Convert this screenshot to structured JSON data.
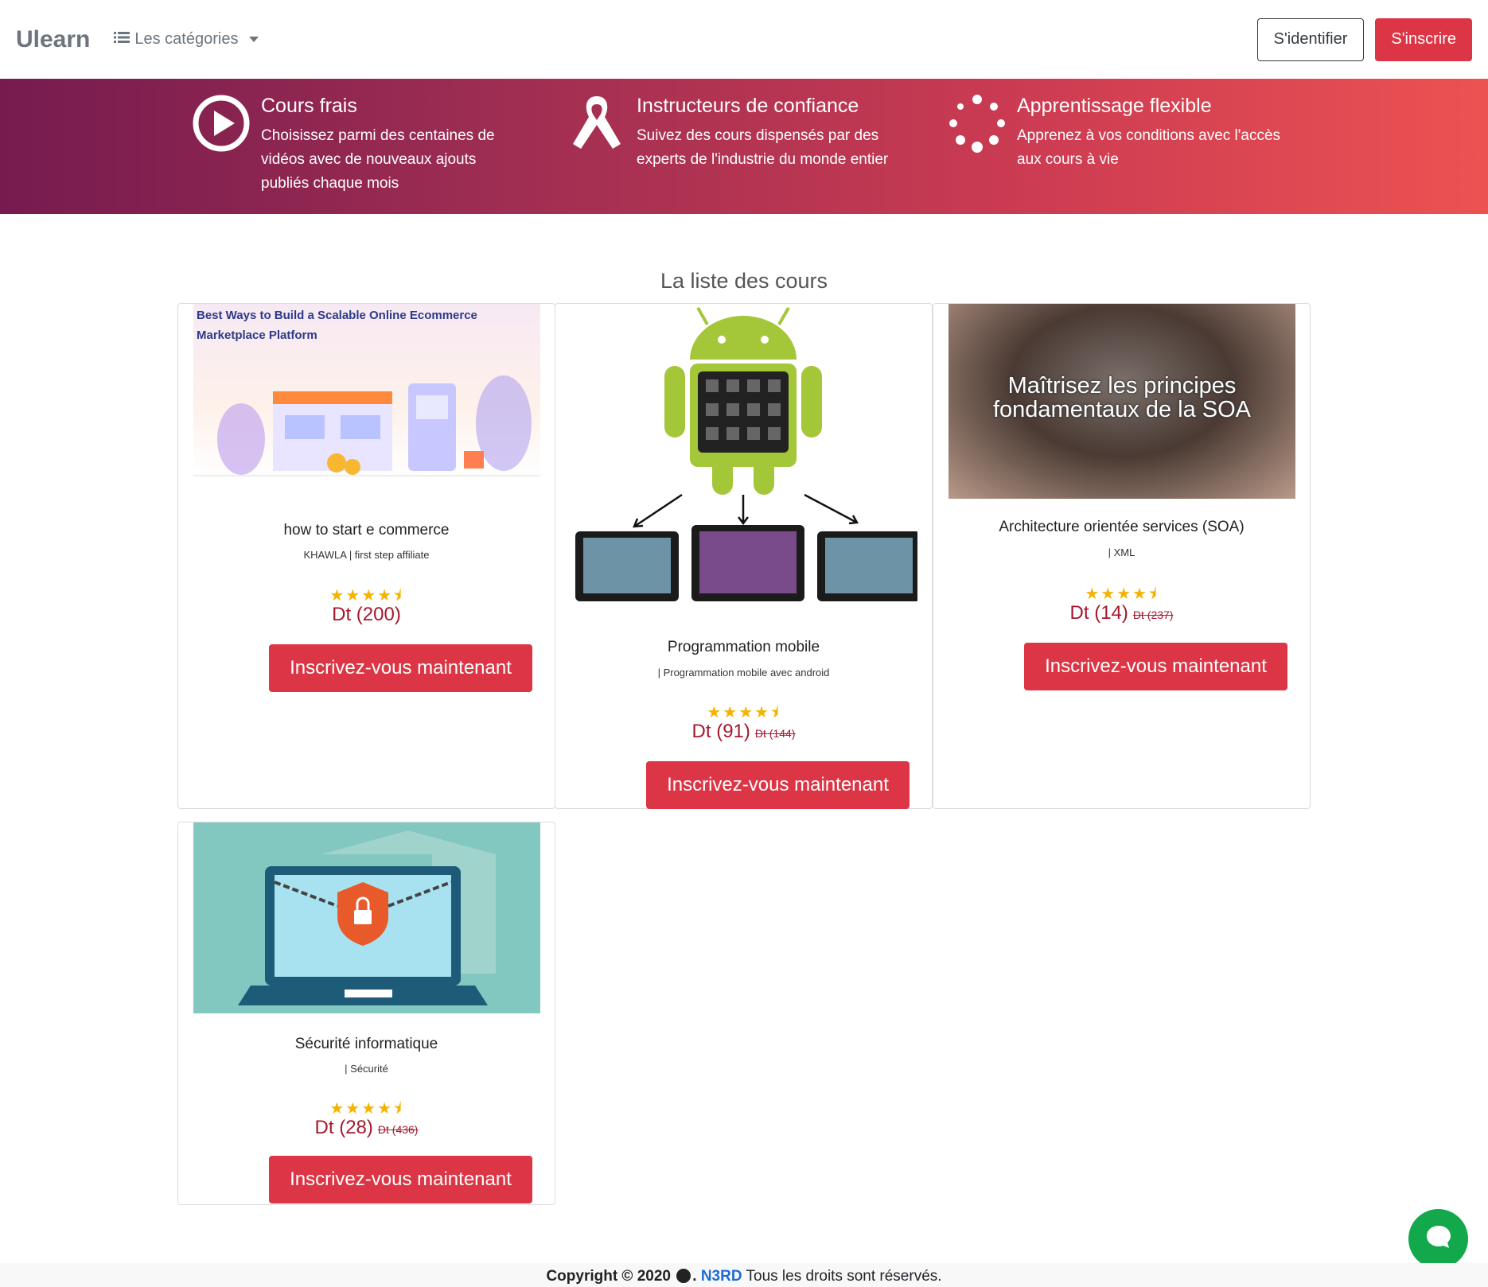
{
  "nav": {
    "brand": "Ulearn",
    "categories_label": "Les catégories",
    "login_label": "S'identifier",
    "signup_label": "S'inscrire"
  },
  "features": [
    {
      "icon": "play-circle-icon",
      "title": "Cours frais",
      "text": "Choisissez parmi des centaines de vidéos avec de nouveaux ajouts publiés chaque mois"
    },
    {
      "icon": "ribbon-icon",
      "title": "Instructeurs de confiance",
      "text": "Suivez des cours dispensés par des experts de l'industrie du monde entier"
    },
    {
      "icon": "spinner-icon",
      "title": "Apprentissage flexible",
      "text": "Apprenez à vos conditions avec l'accès aux cours à vie"
    }
  ],
  "section_title": "La liste des cours",
  "courses": [
    {
      "title": "how to start e commerce",
      "subtitle": "KHAWLA | first step affiliate",
      "stars": "★★★★⯨",
      "price": "Dt (200)",
      "old_price": "",
      "button": "Inscrivez-vous maintenant",
      "thumb_text": "Best Ways to Build a Scalable Online Ecommerce Marketplace Platform"
    },
    {
      "title": "Programmation mobile",
      "subtitle": "| Programmation mobile avec android",
      "stars": "★★★★⯨",
      "price": "Dt (91)",
      "old_price": "Dt (144)",
      "button": "Inscrivez-vous maintenant"
    },
    {
      "title": "Architecture orientée services (SOA)",
      "subtitle": "| XML",
      "stars": "★★★★⯨",
      "price": "Dt (14)",
      "old_price": "Dt (237)",
      "button": "Inscrivez-vous maintenant",
      "thumb_text": "Maîtrisez les principes fondamentaux de la SOA"
    },
    {
      "title": "Sécurité informatique",
      "subtitle": "| Sécurité",
      "stars": "★★★★⯨",
      "price": "Dt (28)",
      "old_price": "Dt (436)",
      "button": "Inscrivez-vous maintenant"
    }
  ],
  "footer": {
    "copyright": "Copyright © 2020",
    "brand": "N3RD",
    "rights": "Tous les droits sont réservés."
  },
  "colors": {
    "accent": "#dc3545",
    "price": "#a5192d",
    "chat": "#13a84b"
  }
}
